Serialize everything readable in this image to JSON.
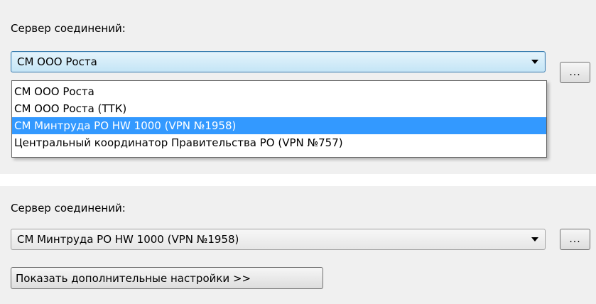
{
  "top": {
    "label": "Сервер соединений:",
    "combo_value": "СМ ООО Роста",
    "browse_label": "...",
    "options": [
      "СМ ООО Роста",
      "СМ ООО Роста (ТТК)",
      "СМ Минтруда РО HW 1000 (VPN №1958)",
      "Центральный координатор Правительства РО (VPN №757)"
    ],
    "highlighted_index": 2
  },
  "bottom": {
    "label": "Сервер соединений:",
    "combo_value": "СМ Минтруда РО HW 1000 (VPN №1958)",
    "browse_label": "...",
    "more_settings_label": "Показать дополнительные настройки >>"
  }
}
